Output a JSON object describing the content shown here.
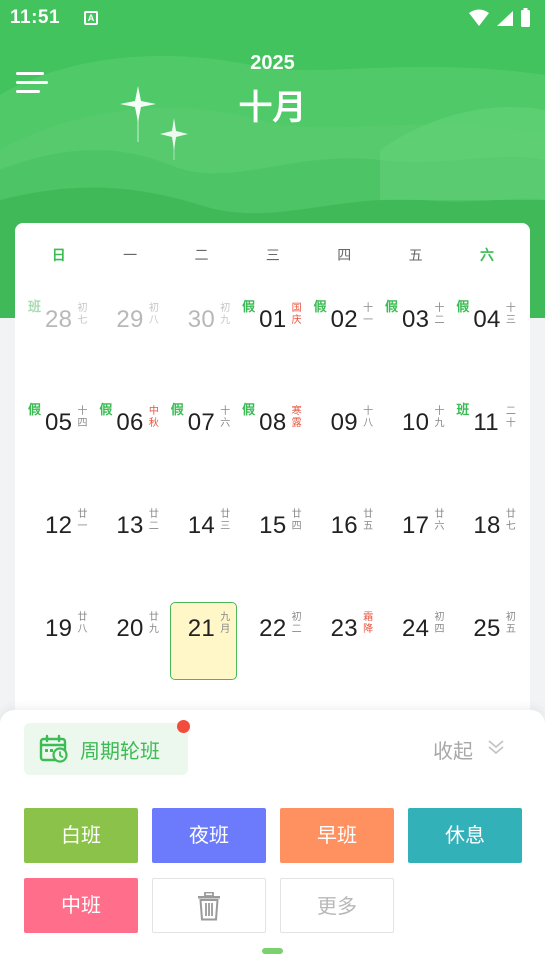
{
  "status_bar": {
    "time": "11:51",
    "notification_icon": "A"
  },
  "header": {
    "year": "2025",
    "month": "十月"
  },
  "weekdays": [
    "日",
    "一",
    "二",
    "三",
    "四",
    "五",
    "六"
  ],
  "colors": {
    "header_green": "#43c35d",
    "accent_green": "#3dbb55",
    "holiday_red": "#e8533f",
    "today_highlight": "#fff7c8"
  },
  "calendar": {
    "weeks": [
      [
        {
          "day": "28",
          "lunar": "初七",
          "tag": "班",
          "dim": true
        },
        {
          "day": "29",
          "lunar": "初八",
          "dim": true
        },
        {
          "day": "30",
          "lunar": "初九",
          "dim": true
        },
        {
          "day": "01",
          "lunar": "国庆",
          "tag": "假",
          "red": true
        },
        {
          "day": "02",
          "lunar": "十一",
          "tag": "假"
        },
        {
          "day": "03",
          "lunar": "十二",
          "tag": "假"
        },
        {
          "day": "04",
          "lunar": "十三",
          "tag": "假"
        }
      ],
      [
        {
          "day": "05",
          "lunar": "十四",
          "tag": "假"
        },
        {
          "day": "06",
          "lunar": "中秋",
          "tag": "假",
          "red": true
        },
        {
          "day": "07",
          "lunar": "十六",
          "tag": "假"
        },
        {
          "day": "08",
          "lunar": "寒露",
          "tag": "假",
          "red": true
        },
        {
          "day": "09",
          "lunar": "十八"
        },
        {
          "day": "10",
          "lunar": "十九"
        },
        {
          "day": "11",
          "lunar": "二十",
          "tag": "班"
        }
      ],
      [
        {
          "day": "12",
          "lunar": "廿一"
        },
        {
          "day": "13",
          "lunar": "廿二"
        },
        {
          "day": "14",
          "lunar": "廿三"
        },
        {
          "day": "15",
          "lunar": "廿四"
        },
        {
          "day": "16",
          "lunar": "廿五"
        },
        {
          "day": "17",
          "lunar": "廿六"
        },
        {
          "day": "18",
          "lunar": "廿七"
        }
      ],
      [
        {
          "day": "19",
          "lunar": "廿八"
        },
        {
          "day": "20",
          "lunar": "廿九"
        },
        {
          "day": "21",
          "lunar": "九月",
          "today": true
        },
        {
          "day": "22",
          "lunar": "初二"
        },
        {
          "day": "23",
          "lunar": "霜降",
          "red": true
        },
        {
          "day": "24",
          "lunar": "初四"
        },
        {
          "day": "25",
          "lunar": "初五"
        }
      ]
    ]
  },
  "sheet": {
    "cycle_label": "周期轮班",
    "collapse_label": "收起",
    "shifts": {
      "white": "白班",
      "night": "夜班",
      "early": "早班",
      "rest": "休息",
      "middle": "中班",
      "more": "更多"
    },
    "icons": {
      "cycle": "calendar-cycle-icon",
      "collapse": "double-chevron-down-icon",
      "delete": "trash-icon"
    }
  }
}
